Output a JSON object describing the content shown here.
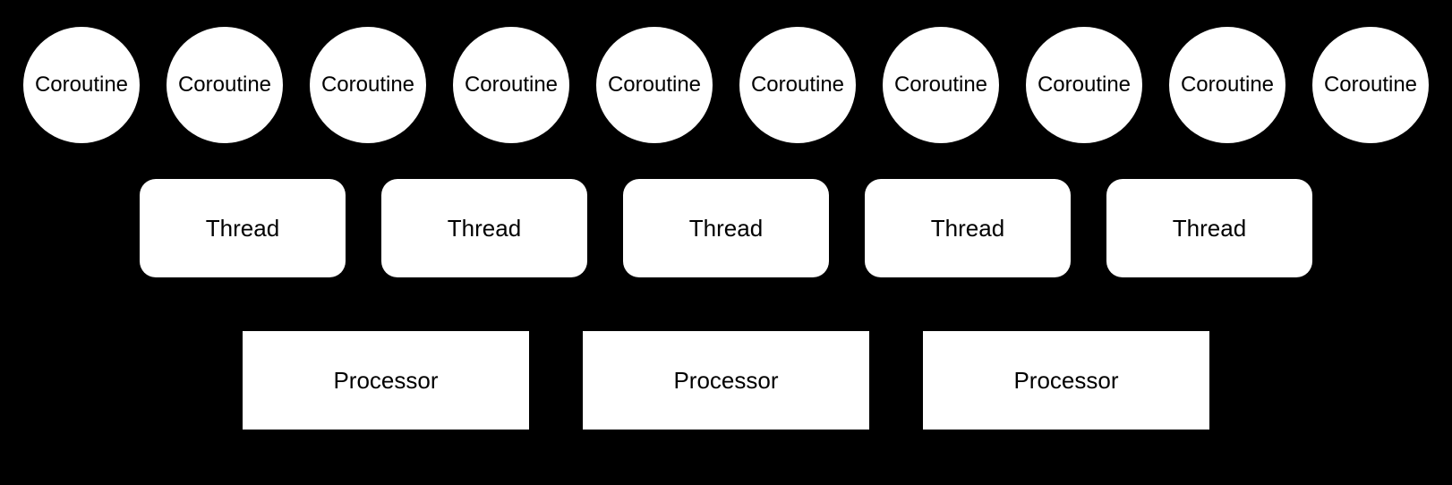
{
  "diagram": {
    "rows": [
      {
        "type": "coroutine",
        "items": [
          {
            "label": "Coroutine"
          },
          {
            "label": "Coroutine"
          },
          {
            "label": "Coroutine"
          },
          {
            "label": "Coroutine"
          },
          {
            "label": "Coroutine"
          },
          {
            "label": "Coroutine"
          },
          {
            "label": "Coroutine"
          },
          {
            "label": "Coroutine"
          },
          {
            "label": "Coroutine"
          },
          {
            "label": "Coroutine"
          }
        ]
      },
      {
        "type": "thread",
        "items": [
          {
            "label": "Thread"
          },
          {
            "label": "Thread"
          },
          {
            "label": "Thread"
          },
          {
            "label": "Thread"
          },
          {
            "label": "Thread"
          }
        ]
      },
      {
        "type": "processor",
        "items": [
          {
            "label": "Processor"
          },
          {
            "label": "Processor"
          },
          {
            "label": "Processor"
          }
        ]
      }
    ]
  }
}
